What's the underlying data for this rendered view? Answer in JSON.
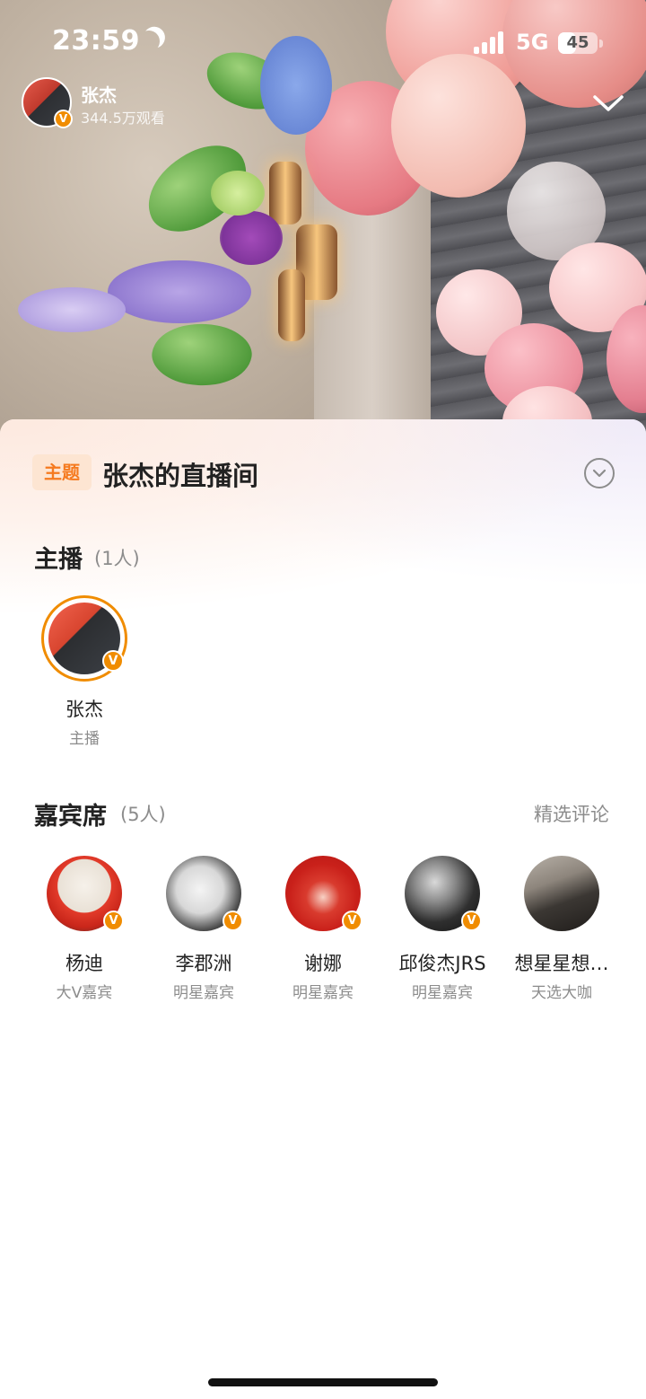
{
  "status_bar": {
    "time": "23:59",
    "network": "5G",
    "battery": "45",
    "battery_level": 0.45
  },
  "live": {
    "host_name": "张杰",
    "viewers": "344.5万观看",
    "verified_badge": "V"
  },
  "topic": {
    "tag": "主题",
    "title": "张杰的直播间"
  },
  "hosts_section": {
    "title": "主播",
    "count": "(1人)",
    "items": [
      {
        "name": "张杰",
        "role": "主播",
        "badge": "V"
      }
    ]
  },
  "guests_section": {
    "title": "嘉宾席",
    "count": "(5人)",
    "link": "精选评论",
    "items": [
      {
        "name": "杨迪",
        "role": "大V嘉宾",
        "badge": "V"
      },
      {
        "name": "李郡洲",
        "role": "明星嘉宾",
        "badge": "V"
      },
      {
        "name": "谢娜",
        "role": "明星嘉宾",
        "badge": "V"
      },
      {
        "name": "邱俊杰JRS",
        "role": "明星嘉宾",
        "badge": "V"
      },
      {
        "name": "想星星想…",
        "role": "天选大咖"
      }
    ]
  },
  "colors": {
    "accent_orange": "#f08c00",
    "tag_text": "#f57a1f",
    "tag_bg": "#fde5d2",
    "muted_text": "#8c8c8c"
  },
  "icons": {
    "moon": "moon-icon",
    "signal": "signal-icon",
    "battery": "battery-icon",
    "collapse_top": "chevron-down-icon",
    "collapse_sheet": "chevron-circle-icon",
    "verified": "verified-v-icon"
  }
}
